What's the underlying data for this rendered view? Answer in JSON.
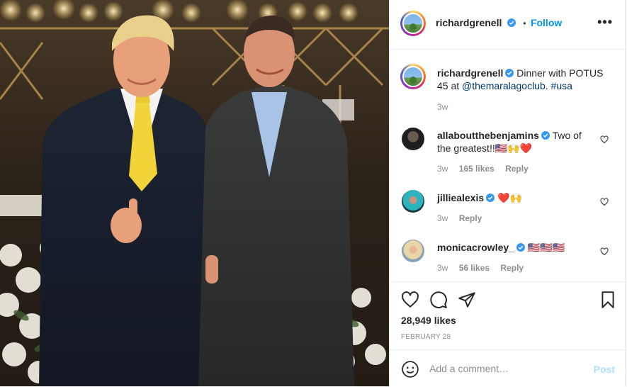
{
  "post": {
    "username": "richardgrenell",
    "follow_label": "Follow",
    "separator": "•",
    "more_label": "•••",
    "caption_plain": "Dinner with POTUS 45 at",
    "caption_mention": "@themaralagoclub",
    "caption_dot": ".",
    "caption_hashtag": "#usa",
    "caption_time": "3w",
    "photo_alt": "Two men in suits posing in front of white flowers and candles"
  },
  "comments": [
    {
      "username": "allaboutthebenjamins",
      "text": "Two of the greatest!!🇺🇸🙌❤️",
      "time": "3w",
      "likes": "165 likes",
      "reply": "Reply"
    },
    {
      "username": "jilliealexis",
      "text": "❤️🙌",
      "time": "3w",
      "likes": "",
      "reply": "Reply"
    },
    {
      "username": "monicacrowley_",
      "text": "🇺🇸🇺🇸🇺🇸",
      "time": "3w",
      "likes": "56 likes",
      "reply": "Reply"
    }
  ],
  "stats": {
    "likes": "28,949 likes",
    "date": "FEBRUARY 28"
  },
  "composer": {
    "placeholder": "Add a comment…",
    "post_label": "Post"
  },
  "colors": {
    "accent": "#0095f6",
    "verified": "#3897f0",
    "post_disabled": "#b2dffc",
    "muted": "#8e8e8e"
  }
}
